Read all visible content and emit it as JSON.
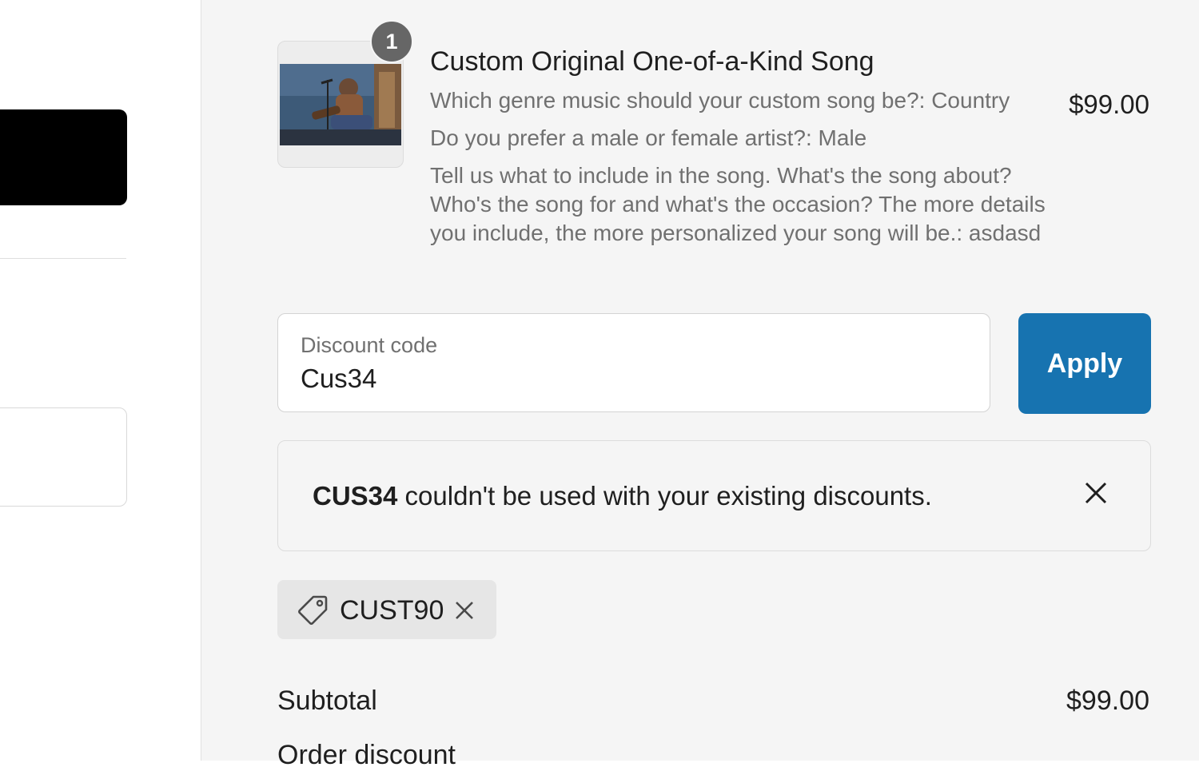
{
  "product": {
    "quantity": "1",
    "title": "Custom Original One-of-a-Kind Song",
    "options": [
      "Which genre music should your custom song be?: Country",
      "Do you prefer a male or female artist?: Male",
      "Tell us what to include in the song. What's the song about? Who's the song for and what's the occasion? The more details you include, the more personalized your song will be.: asdasd"
    ],
    "price": "$99.00"
  },
  "discount": {
    "label": "Discount code",
    "value": "Cus34",
    "apply_label": "Apply"
  },
  "error": {
    "code": "CUS34",
    "message": " couldn't be used with your existing discounts."
  },
  "applied_tag": {
    "code": "CUST90"
  },
  "totals": {
    "subtotal_label": "Subtotal",
    "subtotal_value": "$99.00",
    "order_discount_label": "Order discount"
  },
  "colors": {
    "apply_button": "#1773b0",
    "summary_background": "#f5f5f5",
    "left_button": "#000000"
  }
}
